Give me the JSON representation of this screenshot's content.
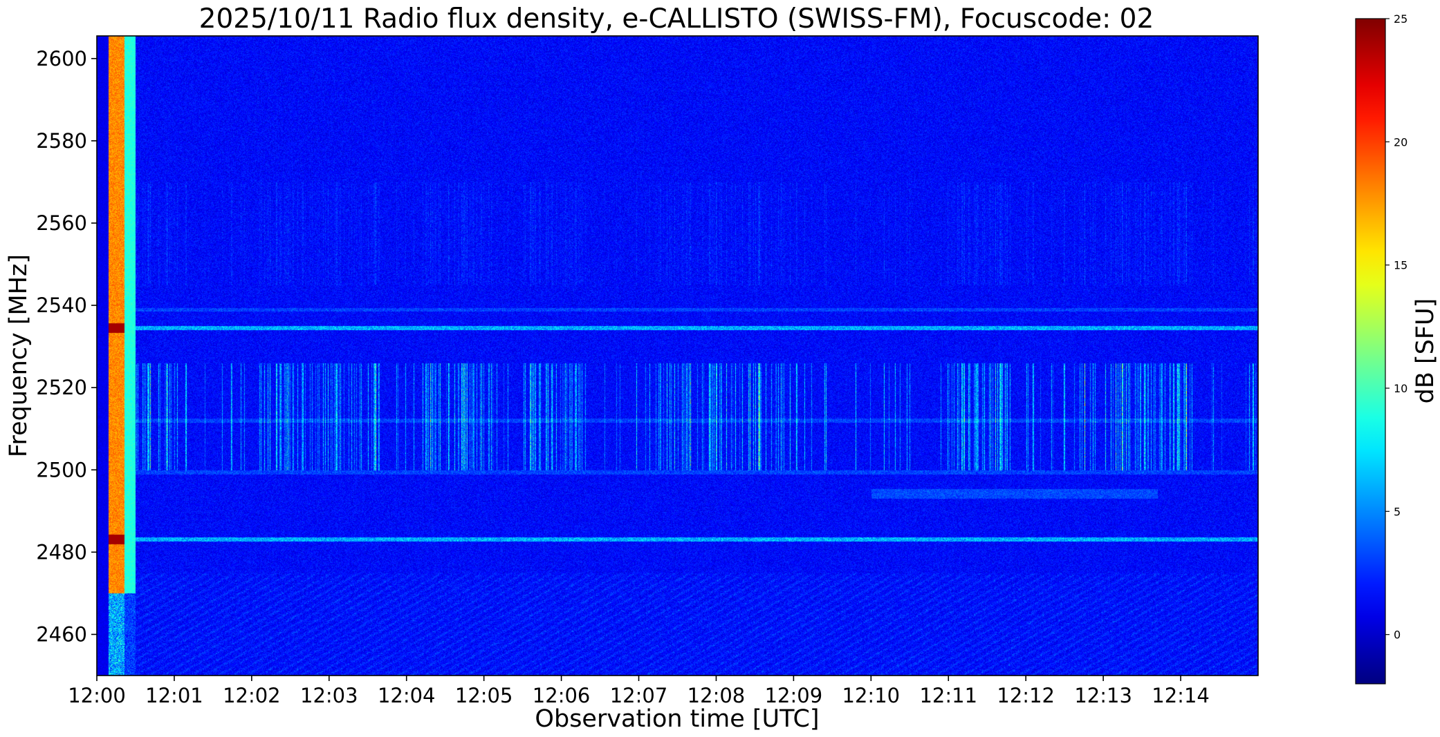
{
  "chart_data": {
    "type": "heatmap",
    "title": "2025/10/11  Radio flux density, e-CALLISTO (SWISS-FM), Focuscode: 02",
    "xlabel": "Observation time [UTC]",
    "ylabel": "Frequency [MHz]",
    "x_tick_labels": [
      "12:00",
      "12:01",
      "12:02",
      "12:03",
      "12:04",
      "12:05",
      "12:06",
      "12:07",
      "12:08",
      "12:09",
      "12:10",
      "12:11",
      "12:12",
      "12:13",
      "12:14"
    ],
    "x_range_minutes": [
      0,
      15
    ],
    "y_ticks": [
      2460,
      2480,
      2500,
      2520,
      2540,
      2560,
      2580,
      2600
    ],
    "y_tick_labels": [
      "2460",
      "2480",
      "2500",
      "2520",
      "2540",
      "2560",
      "2580",
      "2600"
    ],
    "ylim": [
      2450,
      2605.5
    ],
    "colorbar": {
      "label": "dB [SFU]",
      "range": [
        -2,
        25
      ],
      "ticks": [
        0,
        5,
        10,
        15,
        20,
        25
      ],
      "tick_labels": [
        "0",
        "5",
        "10",
        "15",
        "20",
        "25"
      ],
      "colormap": "jet"
    },
    "background_level_db": 1.5,
    "features": {
      "calibration_burst": {
        "time_min": [
          0.15,
          0.5
        ],
        "level_db": 18,
        "noise_source_db": 9
      },
      "horizontal_lines_mhz": [
        2534.5,
        2483.2,
        2499.5,
        2512,
        2539
      ],
      "spiky_band_mhz": [
        2500,
        2526
      ],
      "drifting_band_mhz": [
        2493,
        2495.5
      ],
      "drifting_band_time_min": [
        10.0,
        13.7
      ]
    }
  }
}
